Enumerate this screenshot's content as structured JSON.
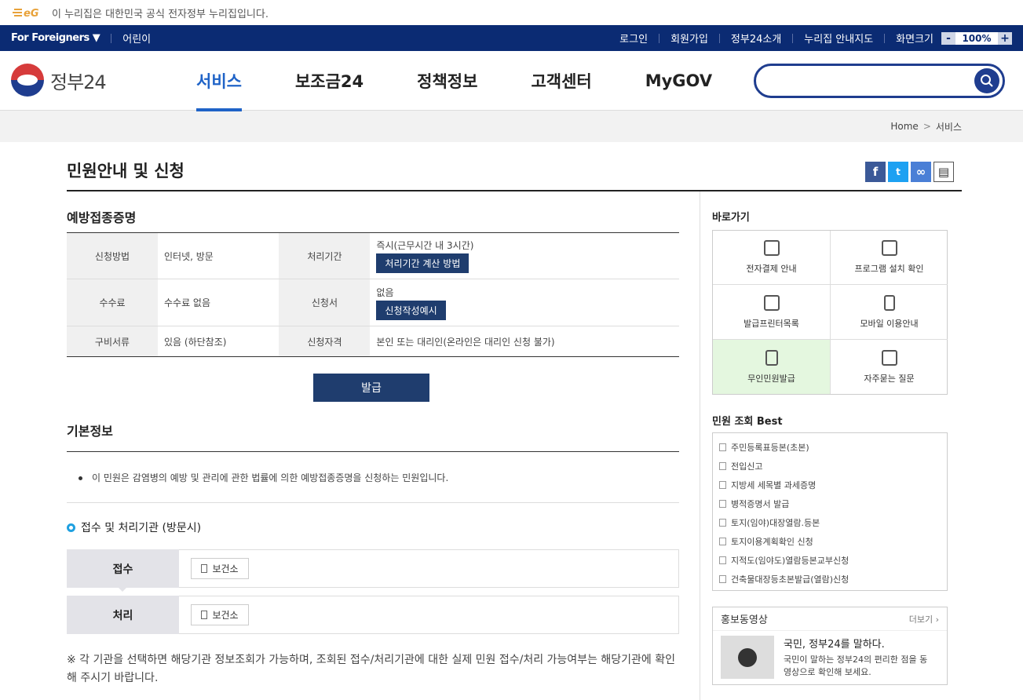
{
  "official_banner": "이 누리집은 대한민국 공식 전자정부 누리집입니다.",
  "topbar": {
    "for_foreigners": "For Foreigners ▼",
    "kids": "어린이",
    "login": "로그인",
    "signup": "회원가입",
    "intro": "정부24소개",
    "sitemap": "누리집 안내지도",
    "font_size": "화면크기",
    "zoom_minus": "-",
    "zoom_value": "100%",
    "zoom_plus": "+"
  },
  "logo": "정부24",
  "nav": [
    "서비스",
    "보조금24",
    "정책정보",
    "고객센터",
    "MyGOV"
  ],
  "breadcrumb": {
    "home": "Home",
    "arrow": ">",
    "current": "서비스"
  },
  "page_title": "민원안내 및 신청",
  "section1": "예방접종증명",
  "info": {
    "method_label": "신청방법",
    "method": "인터넷, 방문",
    "period_label": "처리기간",
    "period": "즉시(근무시간 내 3시간)",
    "period_btn": "처리기간 계산 방법",
    "fee_label": "수수료",
    "fee": "수수료 없음",
    "form_label": "신청서",
    "form": "없음",
    "form_btn": "신청작성예시",
    "docs_label": "구비서류",
    "docs": "있음 (하단참조)",
    "qual_label": "신청자격",
    "qual": "본인 또는 대리인(온라인은 대리인 신청 불가)"
  },
  "issue_btn": "발급",
  "section2": "기본정보",
  "basic_desc": "이 민원은 감염병의 예방 및 관리에 관한 법률에 의한 예방접종증명을 신청하는 민원입니다.",
  "section3": "접수 및 처리기관 (방문시)",
  "receive": {
    "label": "접수",
    "agency": "보건소"
  },
  "process": {
    "label": "처리",
    "agency": "보건소"
  },
  "note": "※ 각 기관을 선택하면 해당기관 정보조회가 가능하며, 조회된 접수/처리기관에 대한 실제 민원 접수/처리 가능여부는 해당기관에 확인해 주시기 바랍니다.",
  "shortcuts_title": "바로가기",
  "shortcuts": [
    "전자결제 안내",
    "프로그램 설치 확인",
    "발급프린터목록",
    "모바일 이용안내",
    "무인민원발급",
    "자주묻는 질문"
  ],
  "best_title": "민원 조회 Best",
  "best": [
    "주민등록표등본(초본)",
    "전입신고",
    "지방세 세목별 과세증명",
    "병적증명서 발급",
    "토지(임야)대장열람.등본",
    "토지이용계획확인 신청",
    "지적도(임야도)열람등본교부신청",
    "건축물대장등초본발급(열람)신청"
  ],
  "promo": {
    "title": "홍보동영상",
    "more": "더보기 ›",
    "headline": "국민, 정부24를 말하다.",
    "desc": "국민이 말하는 정부24의 편리한 점을 동영상으로 확인해 보세요."
  },
  "colors": {
    "navy": "#0b2b73",
    "accent": "#1f63c7",
    "button": "#1f3d6e",
    "highlight": "#e4f7df"
  }
}
